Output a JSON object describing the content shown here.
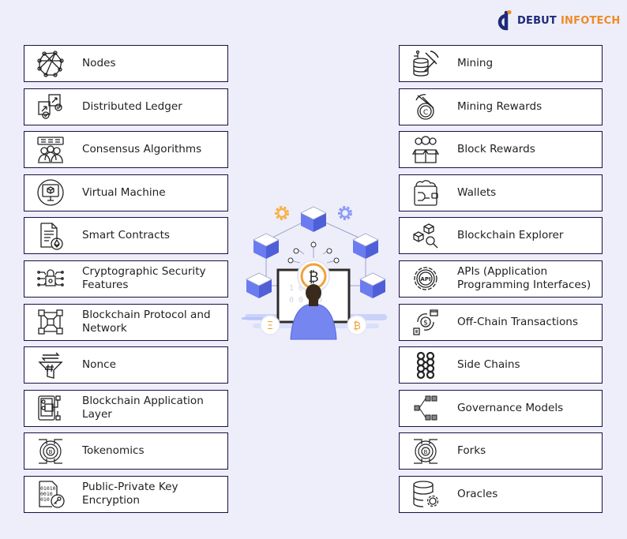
{
  "brand": {
    "name_part1": "DEBUT",
    "name_part2": "INFOTECH",
    "colors": {
      "primary": "#1E2A78",
      "accent": "#F08A24"
    }
  },
  "theme": {
    "background": "#EEEEFB",
    "box_border": "#1B0E45",
    "box_fill": "#FFFFFF",
    "text": "#1F1F1F"
  },
  "left_items": [
    {
      "label": "Nodes",
      "icon": "network-nodes-icon"
    },
    {
      "label": "Distributed Ledger",
      "icon": "distributed-ledger-icon"
    },
    {
      "label": "Consensus Algorithms",
      "icon": "consensus-group-icon"
    },
    {
      "label": "Virtual Machine",
      "icon": "virtual-machine-icon"
    },
    {
      "label": "Smart Contracts",
      "icon": "smart-contract-icon"
    },
    {
      "label": "Cryptographic Security Features",
      "icon": "crypto-lock-icon"
    },
    {
      "label": "Blockchain Protocol and Network",
      "icon": "blockchain-network-icon"
    },
    {
      "label": "Nonce",
      "icon": "nonce-funnel-icon"
    },
    {
      "label": "Blockchain Application Layer",
      "icon": "application-layer-icon"
    },
    {
      "label": "Tokenomics",
      "icon": "tokenomics-coin-icon"
    },
    {
      "label": "Public-Private Key Encryption",
      "icon": "key-encryption-icon"
    }
  ],
  "right_items": [
    {
      "label": "Mining",
      "icon": "mining-pickaxe-icon"
    },
    {
      "label": "Mining Rewards",
      "icon": "mining-reward-icon"
    },
    {
      "label": "Block Rewards",
      "icon": "block-reward-box-icon"
    },
    {
      "label": "Wallets",
      "icon": "wallet-icon"
    },
    {
      "label": "Blockchain Explorer",
      "icon": "blockchain-explorer-icon"
    },
    {
      "label": "APIs (Application Programming Interfaces)",
      "icon": "api-gear-icon"
    },
    {
      "label": "Off-Chain Transactions",
      "icon": "off-chain-transaction-icon"
    },
    {
      "label": "Side Chains",
      "icon": "side-chains-icon"
    },
    {
      "label": "Governance Models",
      "icon": "governance-tree-icon"
    },
    {
      "label": "Forks",
      "icon": "forks-coin-icon"
    },
    {
      "label": "Oracles",
      "icon": "oracle-database-icon"
    }
  ],
  "illustration": {
    "binary_rows": [
      "1 0     1 0",
      "0 0     1 0"
    ],
    "center_coin": "₿",
    "left_coin": "Ξ",
    "right_coin": "₿",
    "colors": {
      "cube": "#6B7BF0",
      "cube_dark": "#4F5FD8",
      "gear_orange": "#F7B24A",
      "gear_blue": "#8C9CF5",
      "coin": "#F0A23A",
      "person_shirt": "#7686F0",
      "hair": "#3A2A1E"
    }
  }
}
